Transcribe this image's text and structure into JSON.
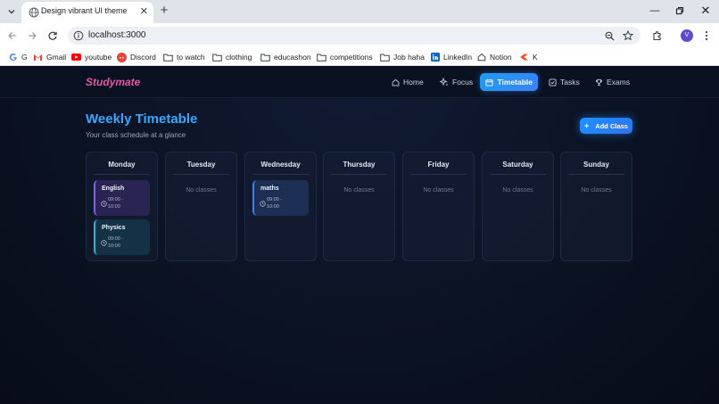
{
  "browser": {
    "tab_title": "Design vibrant UI theme",
    "url": "localhost:3000",
    "avatar_letter": "V",
    "bookmarks": [
      {
        "label": "G"
      },
      {
        "label": "Gmail"
      },
      {
        "label": "youtube"
      },
      {
        "label": "Discord"
      },
      {
        "label": "to watch"
      },
      {
        "label": "clothing"
      },
      {
        "label": "educashon"
      },
      {
        "label": "competitions"
      },
      {
        "label": "Job haha"
      },
      {
        "label": "LinkedIn"
      },
      {
        "label": "Notion"
      },
      {
        "label": "K"
      }
    ]
  },
  "app": {
    "logo": "Studymate",
    "nav": [
      {
        "label": "Home",
        "icon": "home-icon"
      },
      {
        "label": "Focus",
        "icon": "sparkle-icon"
      },
      {
        "label": "Timetable",
        "icon": "calendar-icon",
        "active": true
      },
      {
        "label": "Tasks",
        "icon": "checkbox-icon"
      },
      {
        "label": "Exams",
        "icon": "trophy-icon"
      }
    ],
    "title": "Weekly Timetable",
    "subtitle": "Your class schedule at a glance",
    "add_button": "Add Class",
    "empty_text": "No classes",
    "days": [
      {
        "name": "Monday",
        "classes": [
          {
            "name": "English",
            "time_start": "09:00 -",
            "time_end": "10:00",
            "accent": "#8b5cf6"
          },
          {
            "name": "Physics",
            "time_start": "09:00 -",
            "time_end": "10:00",
            "accent": "#22b8cf"
          }
        ]
      },
      {
        "name": "Tuesday",
        "classes": []
      },
      {
        "name": "Wednesday",
        "classes": [
          {
            "name": "maths",
            "time_start": "09:00 -",
            "time_end": "10:00",
            "accent": "#3b82f6"
          }
        ]
      },
      {
        "name": "Thursday",
        "classes": []
      },
      {
        "name": "Friday",
        "classes": []
      },
      {
        "name": "Saturday",
        "classes": []
      },
      {
        "name": "Sunday",
        "classes": []
      }
    ]
  },
  "colors": {
    "accent_blue": "#3aa7ff",
    "logo_pink": "#e05aa8",
    "background": "#0b1222"
  }
}
